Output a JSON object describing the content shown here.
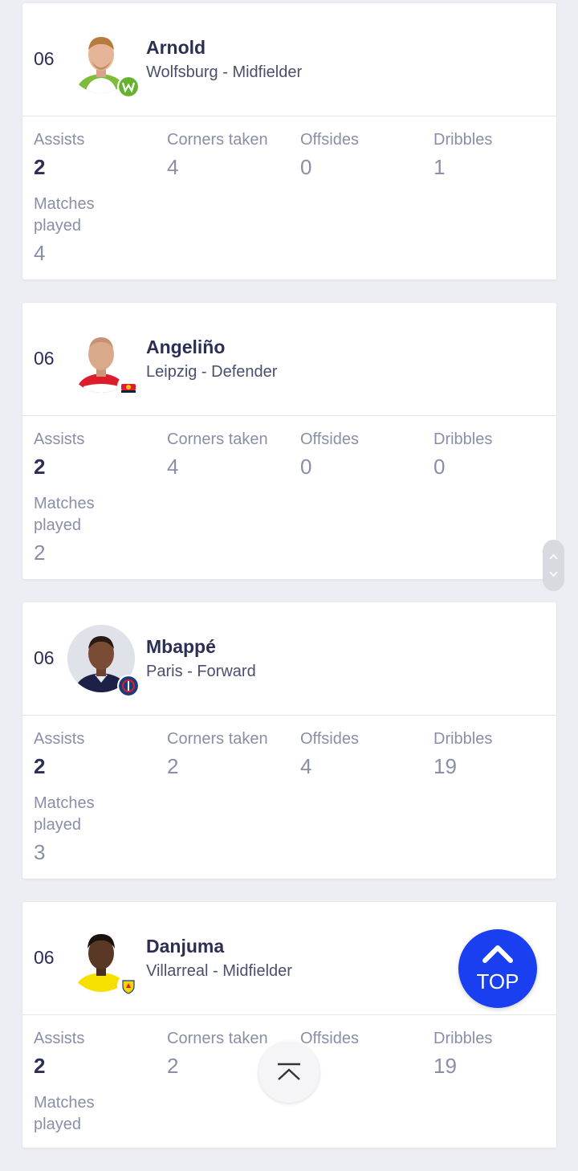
{
  "stat_labels": {
    "assists": "Assists",
    "corners": "Corners taken",
    "offsides": "Offsides",
    "dribbles": "Dribbles",
    "matches": "Matches played"
  },
  "players": [
    {
      "rank": "06",
      "name": "Arnold",
      "team_position": "Wolfsburg - Midfielder",
      "club_badge_icon": "wolfsburg-badge-icon",
      "assists": "2",
      "corners": "4",
      "offsides": "0",
      "dribbles": "1",
      "matches": "4"
    },
    {
      "rank": "06",
      "name": "Angeliño",
      "team_position": "Leipzig - Defender",
      "club_badge_icon": "leipzig-badge-icon",
      "assists": "2",
      "corners": "4",
      "offsides": "0",
      "dribbles": "0",
      "matches": "2"
    },
    {
      "rank": "06",
      "name": "Mbappé",
      "team_position": "Paris - Forward",
      "club_badge_icon": "psg-badge-icon",
      "assists": "2",
      "corners": "2",
      "offsides": "4",
      "dribbles": "19",
      "matches": "3"
    },
    {
      "rank": "06",
      "name": "Danjuma",
      "team_position": "Villarreal - Midfielder",
      "club_badge_icon": "villarreal-badge-icon",
      "assists": "2",
      "corners": "2",
      "offsides": "",
      "dribbles": "19",
      "matches": ""
    }
  ],
  "top_button": {
    "label": "TOP",
    "icon": "chevron-up-icon"
  },
  "scroll_indicator": {
    "icon": "up-down-arrows-icon"
  },
  "scroll_to_top_fab": {
    "icon": "arrow-to-top-icon"
  },
  "colors": {
    "accent": "#1a3ff0",
    "text_dark": "#2b2e55",
    "text_muted": "#8a8ea6",
    "background": "#eceef3"
  }
}
